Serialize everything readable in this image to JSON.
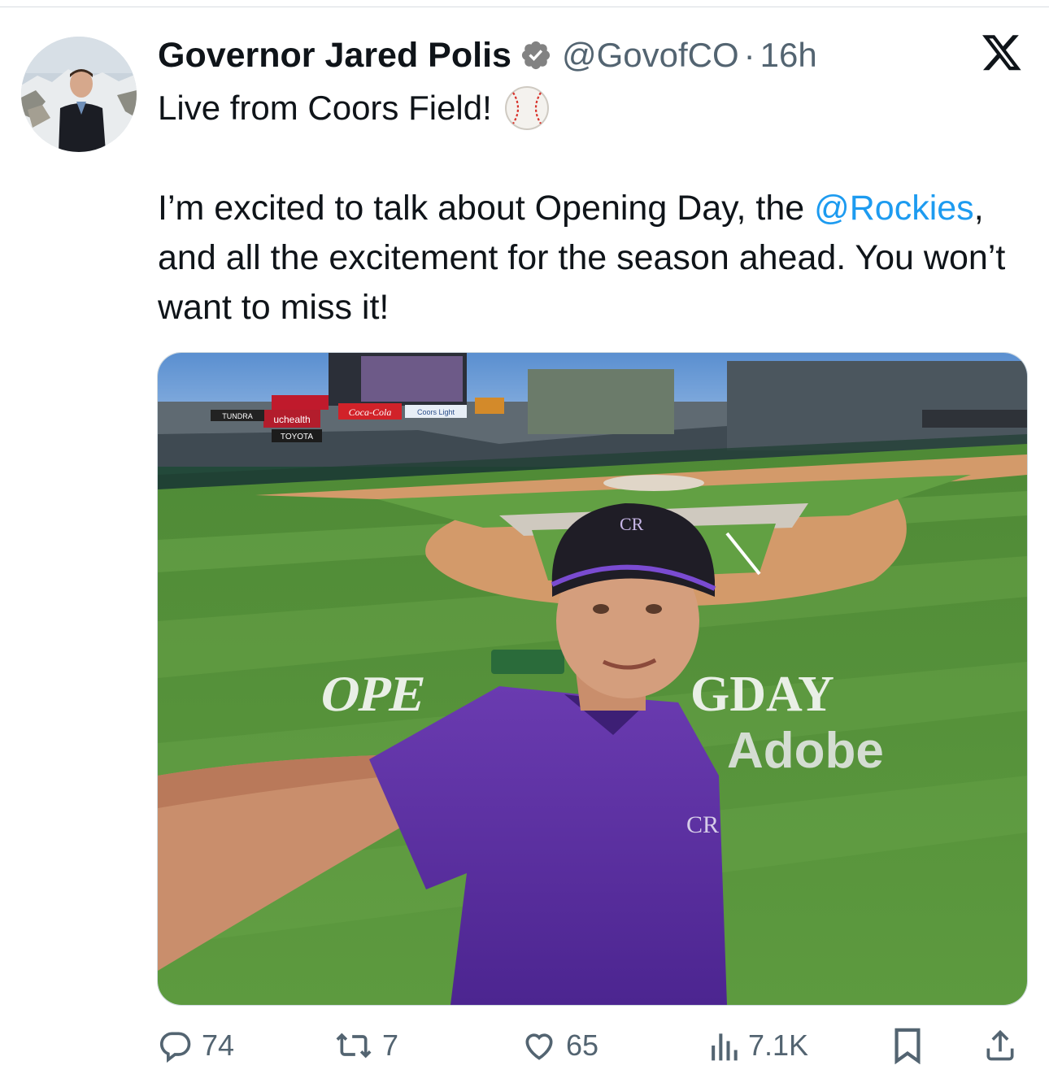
{
  "tweet": {
    "author": {
      "display_name": "Governor Jared Polis",
      "handle": "@GovofCO",
      "verified_icon": "verified-badge-icon"
    },
    "separator": "·",
    "time": "16h",
    "text_line1": "Live from Coors Field!",
    "emoji": "baseball-emoji",
    "body_part1": "I’m excited to talk about Opening Day, the ",
    "mention": "@Rockies",
    "body_part2": ", and all the excitement for the season ahead. You won’t want to miss it!",
    "image_text": {
      "sign_uchealth": "uchealth",
      "sign_toyota": "TOYOTA",
      "sign_tundra": "TUNDRA",
      "sign_cocacola": "Coca-Cola",
      "sign_coorslight": "Coors Light",
      "grass_opening_day": "OPE",
      "grass_opening_day_2": "GDAY",
      "grass_adobe": "Adobe",
      "cap_logo": "CR"
    }
  },
  "actions": {
    "reply_count": "74",
    "retweet_count": "7",
    "like_count": "65",
    "views_count": "7.1K"
  },
  "colors": {
    "accent": "#1d9bf0",
    "secondary_text": "#536471",
    "rockies_purple": "#5b2a9c"
  }
}
